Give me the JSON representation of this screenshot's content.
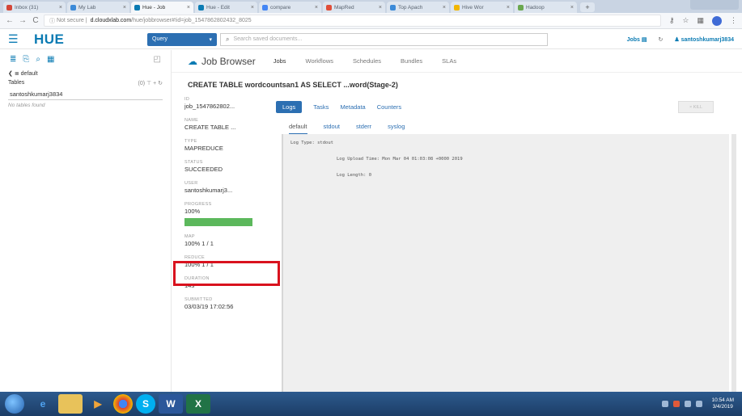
{
  "browser": {
    "tabs": [
      {
        "label": "Inbox (31)",
        "active": false,
        "color": "#d44638"
      },
      {
        "label": "My Lab",
        "active": false,
        "color": "#3b8ad8"
      },
      {
        "label": "Hue - Job",
        "active": true,
        "color": "#0b7bb3"
      },
      {
        "label": "Hue - Edit",
        "active": false,
        "color": "#0b7bb3"
      },
      {
        "label": "compare",
        "active": false,
        "color": "#4285f4"
      },
      {
        "label": "MapRed",
        "active": false,
        "color": "#e04e39"
      },
      {
        "label": "Top Apach",
        "active": false,
        "color": "#3b8ad8"
      },
      {
        "label": "Hive Wor",
        "active": false,
        "color": "#f2b600"
      },
      {
        "label": "Hadoop",
        "active": false,
        "color": "#6aa84f"
      }
    ],
    "url_security": "Not secure",
    "url_host": "d.cloudxlab.com",
    "url_path": "/hue/jobbrowser#!id=job_1547862802432_8025"
  },
  "hue": {
    "query_label": "Query",
    "search_placeholder": "Search saved documents...",
    "jobs_label": "Jobs",
    "user": "santoshkumarj3834"
  },
  "assist": {
    "database": "default",
    "tables_label": "Tables",
    "tables_count": "(0)",
    "filter_value": "santoshkumarj3834",
    "empty_text": "No tables found"
  },
  "jobbrowser": {
    "title": "Job Browser",
    "nav": [
      "Jobs",
      "Workflows",
      "Schedules",
      "Bundles",
      "SLAs"
    ],
    "job_title": "CREATE TABLE wordcountsan1 AS SELECT ...word(Stage-2)",
    "props": {
      "id_label": "ID",
      "id": "job_1547862802...",
      "name_label": "NAME",
      "name": "CREATE TABLE ...",
      "type_label": "TYPE",
      "type": "MAPREDUCE",
      "status_label": "STATUS",
      "status": "SUCCEEDED",
      "user_label": "USER",
      "user": "santoshkumarj3...",
      "progress_label": "PROGRESS",
      "progress": "100%",
      "progress_fraction": 1.0,
      "map_label": "MAP",
      "map": "100% 1 / 1",
      "reduce_label": "REDUCE",
      "reduce": "100% 1 / 1",
      "duration_label": "DURATION",
      "duration": "14s",
      "submitted_label": "SUBMITTED",
      "submitted": "03/03/19 17:02:56"
    },
    "tabs": [
      "Logs",
      "Tasks",
      "Metadata",
      "Counters"
    ],
    "kill_label": "KILL",
    "log_tabs": [
      "default",
      "stdout",
      "stderr",
      "syslog"
    ],
    "log": {
      "type": "Log Type: stdout",
      "upload": "Log Upload Time: Mon Mar 04 01:03:08 +0000 2019",
      "length": "Log Length: 0"
    }
  },
  "taskbar": {
    "time": "10:54 AM",
    "date": "3/4/2019"
  }
}
